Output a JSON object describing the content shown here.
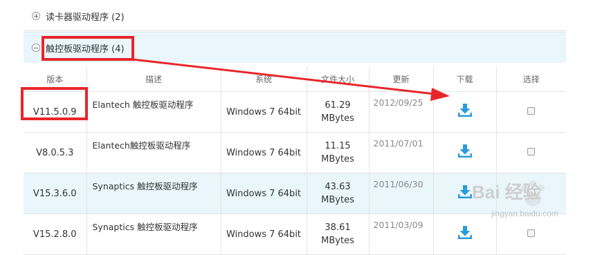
{
  "categories": [
    {
      "label": "读卡器驱动程序 (2)",
      "state": "collapsed"
    },
    {
      "label": "触控板驱动程序 (4)",
      "state": "expanded"
    }
  ],
  "table": {
    "headers": [
      "版本",
      "描述",
      "系统",
      "文件大小",
      "更新",
      "下载",
      "选择"
    ],
    "rows": [
      {
        "version": "V11.5.0.9",
        "description": "Elantech 触控板驱动程序",
        "system": "Windows 7 64bit",
        "size_value": "61.29",
        "size_unit": "MBytes",
        "date": "2012/09/25"
      },
      {
        "version": "V8.0.5.3",
        "description": "Elantech触控板驱动程序",
        "system": "Windows 7 64bit",
        "size_value": "11.15",
        "size_unit": "MBytes",
        "date": "2011/07/01"
      },
      {
        "version": "V15.3.6.0",
        "description": "Synaptics 触控板驱动程序",
        "system": "Windows 7 64bit",
        "size_value": "43.63",
        "size_unit": "MBytes",
        "date": "2011/06/30"
      },
      {
        "version": "V15.2.8.0",
        "description": "Synaptics 触控板驱动程序",
        "system": "Windows 7 64bit",
        "size_value": "38.61",
        "size_unit": "MBytes",
        "date": "2011/03/09"
      }
    ]
  },
  "watermark": {
    "brand": "Bai 经验",
    "url": "jingyan.baidu.com"
  },
  "colors": {
    "accent": "#2a9bdc",
    "highlight": "#e8262a",
    "row_alt": "#e9f6fc"
  },
  "icons": {
    "download": "download-icon",
    "expand": "plus-circle-icon",
    "collapse": "minus-circle-icon"
  }
}
